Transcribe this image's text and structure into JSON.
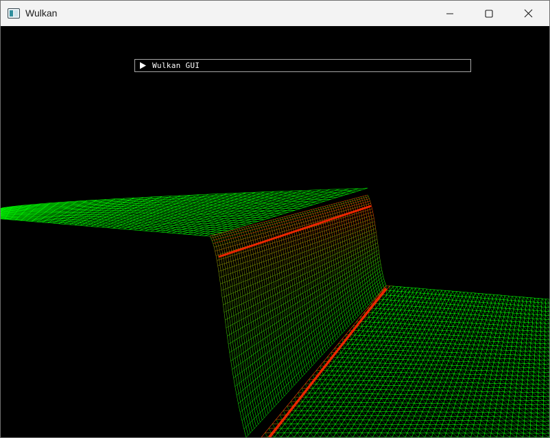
{
  "window": {
    "title": "Wulkan",
    "icon": "app-window-icon",
    "controls": {
      "minimize_icon": "minimize-icon",
      "maximize_icon": "maximize-icon",
      "close_icon": "close-icon"
    }
  },
  "gui": {
    "header_label": "Wulkan GUI",
    "collapsed": true,
    "arrow_icon": "collapse-arrow-right-icon"
  },
  "scene": {
    "background_color": "#000000",
    "wireframe_low_color": "#00ff00",
    "wireframe_high_color": "#ff2000",
    "render_mode": "wireframe"
  }
}
